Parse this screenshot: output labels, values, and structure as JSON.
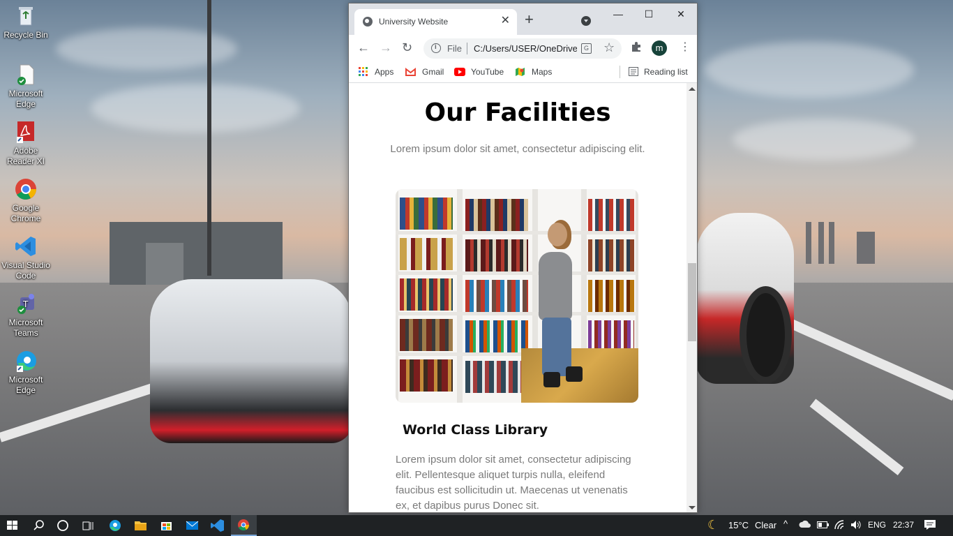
{
  "desktop": {
    "icons": [
      {
        "label": "Recycle Bin",
        "icon": "recycle-bin-icon"
      },
      {
        "label": "Microsoft Edge",
        "icon": "edge-file-icon"
      },
      {
        "label": "Adobe Reader XI",
        "icon": "adobe-reader-icon"
      },
      {
        "label": "Google Chrome",
        "icon": "chrome-icon"
      },
      {
        "label": "Visual Studio Code",
        "icon": "vscode-icon"
      },
      {
        "label": "Microsoft Teams",
        "icon": "teams-icon"
      },
      {
        "label": "Microsoft Edge",
        "icon": "edge-icon"
      }
    ]
  },
  "browser": {
    "tab_title": "University Website",
    "tab_close": "✕",
    "new_tab": "+",
    "window_controls": {
      "minimize": "—",
      "maximize": "☐",
      "close": "✕"
    },
    "nav": {
      "back": "←",
      "forward": "→",
      "reload": "↻"
    },
    "omnibox": {
      "scheme": "File",
      "url": "C:/Users/USER/OneDrive/Desktop/university/index.html"
    },
    "bookmarks": [
      {
        "label": "Apps",
        "icon": "apps-grid-icon"
      },
      {
        "label": "Gmail",
        "icon": "gmail-icon"
      },
      {
        "label": "YouTube",
        "icon": "youtube-icon"
      },
      {
        "label": "Maps",
        "icon": "maps-icon"
      }
    ],
    "reading_list": "Reading list",
    "profile_initial": "m"
  },
  "page": {
    "heading": "Our Facilities",
    "subtitle": "Lorem ipsum dolor sit amet, consectetur adipiscing elit.",
    "card": {
      "title": "World Class Library",
      "text": "Lorem ipsum dolor sit amet, consectetur adipiscing elit. Pellentesque aliquet turpis nulla, eleifend faucibus est sollicitudin ut. Maecenas ut venenatis ex, et dapibus purus Donec sit."
    }
  },
  "taskbar": {
    "weather_temp": "15°C",
    "weather_desc": "Clear",
    "language": "ENG",
    "time": "22:37"
  },
  "colors": {
    "avatar": "#17433a",
    "taskbar": "#1f2224",
    "accent_vscode": "#2c8ee0",
    "chrome_red": "#db4437"
  }
}
